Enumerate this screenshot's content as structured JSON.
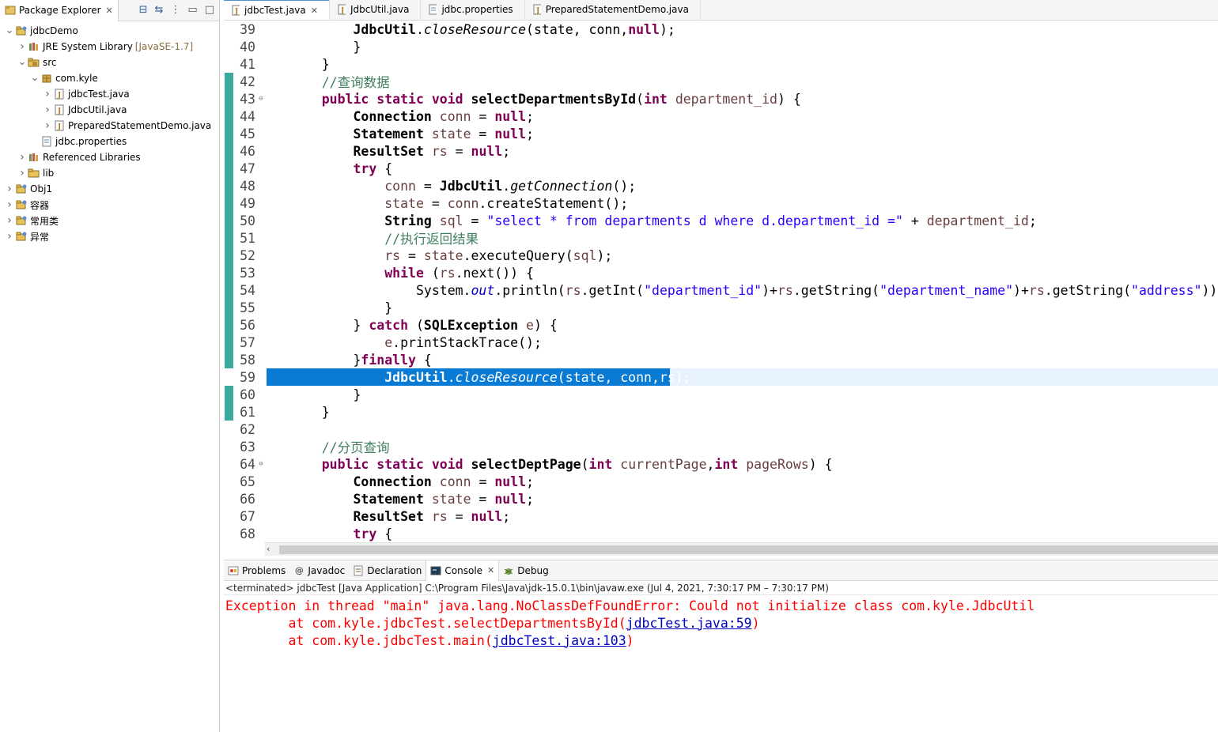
{
  "explorer": {
    "title": "Package Explorer",
    "tree": [
      {
        "depth": 0,
        "twisty": "v",
        "icon": "project",
        "label": "jdbcDemo",
        "decor": ""
      },
      {
        "depth": 1,
        "twisty": ">",
        "icon": "library",
        "label": "JRE System Library",
        "decor": "[JavaSE-1.7]"
      },
      {
        "depth": 1,
        "twisty": "v",
        "icon": "srcfolder",
        "label": "src",
        "decor": ""
      },
      {
        "depth": 2,
        "twisty": "v",
        "icon": "package",
        "label": "com.kyle",
        "decor": ""
      },
      {
        "depth": 3,
        "twisty": ">",
        "icon": "javafile",
        "label": "jdbcTest.java",
        "decor": ""
      },
      {
        "depth": 3,
        "twisty": ">",
        "icon": "javafile",
        "label": "JdbcUtil.java",
        "decor": ""
      },
      {
        "depth": 3,
        "twisty": ">",
        "icon": "javafile",
        "label": "PreparedStatementDemo.java",
        "decor": ""
      },
      {
        "depth": 2,
        "twisty": "",
        "icon": "propfile",
        "label": "jdbc.properties",
        "decor": ""
      },
      {
        "depth": 1,
        "twisty": ">",
        "icon": "library",
        "label": "Referenced Libraries",
        "decor": ""
      },
      {
        "depth": 1,
        "twisty": ">",
        "icon": "folder",
        "label": "lib",
        "decor": ""
      },
      {
        "depth": 0,
        "twisty": ">",
        "icon": "project",
        "label": "Obj1",
        "decor": ""
      },
      {
        "depth": 0,
        "twisty": ">",
        "icon": "project",
        "label": "容器",
        "decor": ""
      },
      {
        "depth": 0,
        "twisty": ">",
        "icon": "project",
        "label": "常用类",
        "decor": ""
      },
      {
        "depth": 0,
        "twisty": ">",
        "icon": "project",
        "label": "异常",
        "decor": ""
      }
    ]
  },
  "editor": {
    "tabs": [
      {
        "label": "jdbcTest.java",
        "active": true,
        "closable": true
      },
      {
        "label": "JdbcUtil.java",
        "active": false,
        "closable": false
      },
      {
        "label": "jdbc.properties",
        "active": false,
        "closable": false
      },
      {
        "label": "PreparedStatementDemo.java",
        "active": false,
        "closable": false
      }
    ],
    "selected_line": "59",
    "lines": [
      {
        "n": "39",
        "fold": "",
        "indent": 8,
        "tokens": [
          [
            "ty",
            "JdbcUtil"
          ],
          [
            "",
            "."
          ],
          [
            "st",
            "closeResource"
          ],
          [
            "",
            "(state, conn,"
          ],
          [
            "kw",
            "null"
          ],
          [
            "",
            ");"
          ]
        ]
      },
      {
        "n": "40",
        "fold": "",
        "indent": 8,
        "tokens": [
          [
            "",
            "}"
          ]
        ]
      },
      {
        "n": "41",
        "fold": "",
        "indent": 4,
        "tokens": [
          [
            "",
            "}"
          ]
        ]
      },
      {
        "n": "42",
        "fold": "",
        "indent": 4,
        "tokens": [
          [
            "cm",
            "//查询数据"
          ]
        ]
      },
      {
        "n": "43",
        "fold": "⊖",
        "indent": 4,
        "tokens": [
          [
            "kw",
            "public static void "
          ],
          [
            "ty",
            "selectDepartmentsById"
          ],
          [
            "",
            "("
          ],
          [
            "kw",
            "int "
          ],
          [
            "var",
            "department_id"
          ],
          [
            "",
            ") {"
          ]
        ]
      },
      {
        "n": "44",
        "fold": "",
        "indent": 8,
        "tokens": [
          [
            "ty",
            "Connection "
          ],
          [
            "var",
            "conn"
          ],
          [
            "",
            " = "
          ],
          [
            "kw",
            "null"
          ],
          [
            "",
            ";"
          ]
        ]
      },
      {
        "n": "45",
        "fold": "",
        "indent": 8,
        "tokens": [
          [
            "ty",
            "Statement "
          ],
          [
            "var",
            "state"
          ],
          [
            "",
            " = "
          ],
          [
            "kw",
            "null"
          ],
          [
            "",
            ";"
          ]
        ]
      },
      {
        "n": "46",
        "fold": "",
        "indent": 8,
        "tokens": [
          [
            "ty",
            "ResultSet "
          ],
          [
            "var",
            "rs"
          ],
          [
            "",
            " = "
          ],
          [
            "kw",
            "null"
          ],
          [
            "",
            ";"
          ]
        ]
      },
      {
        "n": "47",
        "fold": "",
        "indent": 8,
        "tokens": [
          [
            "kw",
            "try"
          ],
          [
            "",
            " {"
          ]
        ]
      },
      {
        "n": "48",
        "fold": "",
        "indent": 12,
        "tokens": [
          [
            "var",
            "conn"
          ],
          [
            "",
            " = "
          ],
          [
            "ty",
            "JdbcUtil"
          ],
          [
            "",
            "."
          ],
          [
            "st",
            "getConnection"
          ],
          [
            "",
            "();"
          ]
        ]
      },
      {
        "n": "49",
        "fold": "",
        "indent": 12,
        "tokens": [
          [
            "var",
            "state"
          ],
          [
            "",
            " = "
          ],
          [
            "var",
            "conn"
          ],
          [
            "",
            ".createStatement();"
          ]
        ]
      },
      {
        "n": "50",
        "fold": "",
        "indent": 12,
        "tokens": [
          [
            "ty",
            "String "
          ],
          [
            "var",
            "sql"
          ],
          [
            "",
            " = "
          ],
          [
            "str",
            "\"select * from departments d where d.department_id =\""
          ],
          [
            "",
            " + "
          ],
          [
            "var",
            "department_id"
          ],
          [
            "",
            ";"
          ]
        ]
      },
      {
        "n": "51",
        "fold": "",
        "indent": 12,
        "tokens": [
          [
            "cm",
            "//执行返回结果"
          ]
        ]
      },
      {
        "n": "52",
        "fold": "",
        "indent": 12,
        "tokens": [
          [
            "var",
            "rs"
          ],
          [
            "",
            " = "
          ],
          [
            "var",
            "state"
          ],
          [
            "",
            ".executeQuery("
          ],
          [
            "var",
            "sql"
          ],
          [
            "",
            ");"
          ]
        ]
      },
      {
        "n": "53",
        "fold": "",
        "indent": 12,
        "tokens": [
          [
            "kw",
            "while"
          ],
          [
            "",
            " ("
          ],
          [
            "var",
            "rs"
          ],
          [
            "",
            ".next()) {"
          ]
        ]
      },
      {
        "n": "54",
        "fold": "",
        "indent": 16,
        "tokens": [
          [
            "",
            "System."
          ],
          [
            "fld",
            "out"
          ],
          [
            "",
            ".println("
          ],
          [
            "var",
            "rs"
          ],
          [
            "",
            ".getInt("
          ],
          [
            "str",
            "\"department_id\""
          ],
          [
            "",
            ")+"
          ],
          [
            "var",
            "rs"
          ],
          [
            "",
            ".getString("
          ],
          [
            "str",
            "\"department_name\""
          ],
          [
            "",
            ")+"
          ],
          [
            "var",
            "rs"
          ],
          [
            "",
            ".getString("
          ],
          [
            "str",
            "\"address\""
          ],
          [
            "",
            "));"
          ]
        ]
      },
      {
        "n": "55",
        "fold": "",
        "indent": 12,
        "tokens": [
          [
            "",
            "}"
          ]
        ]
      },
      {
        "n": "56",
        "fold": "",
        "indent": 8,
        "tokens": [
          [
            "",
            "} "
          ],
          [
            "kw",
            "catch"
          ],
          [
            "",
            " ("
          ],
          [
            "ty",
            "SQLException "
          ],
          [
            "var",
            "e"
          ],
          [
            "",
            ") {"
          ]
        ]
      },
      {
        "n": "57",
        "fold": "",
        "indent": 12,
        "tokens": [
          [
            "var",
            "e"
          ],
          [
            "",
            ".printStackTrace();"
          ]
        ]
      },
      {
        "n": "58",
        "fold": "",
        "indent": 8,
        "tokens": [
          [
            "",
            "}"
          ],
          [
            "kw",
            "finally"
          ],
          [
            "",
            " {"
          ]
        ]
      },
      {
        "n": "59",
        "fold": "",
        "indent": 12,
        "tokens": [
          [
            "ty",
            "JdbcUtil"
          ],
          [
            "",
            "."
          ],
          [
            "st",
            "closeResource"
          ],
          [
            "",
            "(state, conn,rs);"
          ]
        ]
      },
      {
        "n": "60",
        "fold": "",
        "indent": 8,
        "tokens": [
          [
            "",
            "}"
          ]
        ]
      },
      {
        "n": "61",
        "fold": "",
        "indent": 4,
        "tokens": [
          [
            "",
            "}"
          ]
        ]
      },
      {
        "n": "62",
        "fold": "",
        "indent": 0,
        "tokens": []
      },
      {
        "n": "63",
        "fold": "",
        "indent": 4,
        "tokens": [
          [
            "cm",
            "//分页查询"
          ]
        ]
      },
      {
        "n": "64",
        "fold": "⊖",
        "indent": 4,
        "tokens": [
          [
            "kw",
            "public static void "
          ],
          [
            "ty",
            "selectDeptPage"
          ],
          [
            "",
            "("
          ],
          [
            "kw",
            "int "
          ],
          [
            "var",
            "currentPage"
          ],
          [
            "",
            ","
          ],
          [
            "kw",
            "int "
          ],
          [
            "var",
            "pageRows"
          ],
          [
            "",
            ") {"
          ]
        ]
      },
      {
        "n": "65",
        "fold": "",
        "indent": 8,
        "tokens": [
          [
            "ty",
            "Connection "
          ],
          [
            "var",
            "conn"
          ],
          [
            "",
            " = "
          ],
          [
            "kw",
            "null"
          ],
          [
            "",
            ";"
          ]
        ]
      },
      {
        "n": "66",
        "fold": "",
        "indent": 8,
        "tokens": [
          [
            "ty",
            "Statement "
          ],
          [
            "var",
            "state"
          ],
          [
            "",
            " = "
          ],
          [
            "kw",
            "null"
          ],
          [
            "",
            ";"
          ]
        ]
      },
      {
        "n": "67",
        "fold": "",
        "indent": 8,
        "tokens": [
          [
            "ty",
            "ResultSet "
          ],
          [
            "var",
            "rs"
          ],
          [
            "",
            " = "
          ],
          [
            "kw",
            "null"
          ],
          [
            "",
            ";"
          ]
        ]
      },
      {
        "n": "68",
        "fold": "",
        "indent": 8,
        "tokens": [
          [
            "kw",
            "try"
          ],
          [
            "",
            " {"
          ]
        ]
      }
    ]
  },
  "bottom": {
    "tabs": [
      {
        "label": "Problems",
        "icon": "problems-icon",
        "active": false
      },
      {
        "label": "Javadoc",
        "icon": "javadoc-icon",
        "active": false
      },
      {
        "label": "Declaration",
        "icon": "declaration-icon",
        "active": false
      },
      {
        "label": "Console",
        "icon": "console-icon",
        "active": true
      },
      {
        "label": "Debug",
        "icon": "debug-icon",
        "active": false
      }
    ],
    "console_header": "<terminated> jdbcTest [Java Application] C:\\Program Files\\Java\\jdk-15.0.1\\bin\\javaw.exe  (Jul 4, 2021, 7:30:17 PM – 7:30:17 PM)",
    "output": [
      {
        "prefix": "Exception in thread \"main\" java.lang.NoClassDefFoundError: Could not initialize class com.kyle.JdbcUtil",
        "link": "",
        "suffix": ""
      },
      {
        "prefix": "\tat com.kyle.jdbcTest.selectDepartmentsById(",
        "link": "jdbcTest.java:59",
        "suffix": ")"
      },
      {
        "prefix": "\tat com.kyle.jdbcTest.main(",
        "link": "jdbcTest.java:103",
        "suffix": ")"
      }
    ]
  },
  "colors": {
    "keyword": "#7f0055",
    "string": "#2a00ff",
    "comment": "#3f7f5f",
    "selection": "#0a7bd4",
    "error": "#ff0000",
    "change_ruler": "#3ea99f"
  }
}
